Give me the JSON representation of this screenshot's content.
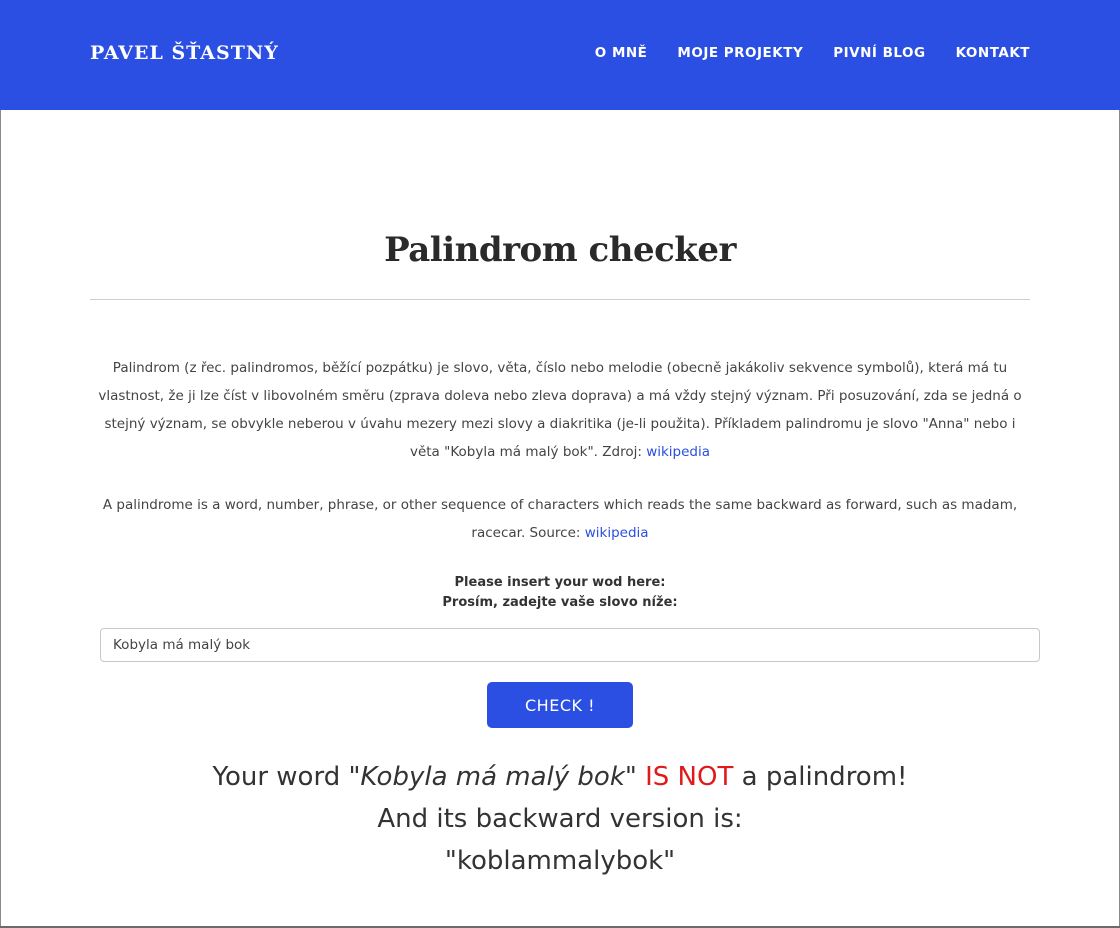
{
  "header": {
    "brand": "PAVEL ŠŤASTNÝ",
    "nav": [
      "O MNĚ",
      "MOJE PROJEKTY",
      "PIVNÍ BLOG",
      "KONTAKT"
    ]
  },
  "main": {
    "title": "Palindrom checker",
    "description_cz": {
      "text": "Palindrom (z řec. palindromos, běžící pozpátku) je slovo, věta, číslo nebo melodie (obecně jakákoliv sekvence symbolů), která má tu vlastnost, že ji lze číst v libovolném směru (zprava doleva nebo zleva doprava) a má vždy stejný význam. Při posuzování, zda se jedná o stejný význam, se obvykle neberou v úvahu mezery mezi slovy a diakritika (je-li použita). Příkladem palindromu je slovo \"Anna\" nebo i věta \"Kobyla má malý bok\". Zdroj:",
      "link": "wikipedia"
    },
    "description_en": {
      "text": "A palindrome is a word, number, phrase, or other sequence of characters which reads the same backward as forward, such as madam, racecar. Source:",
      "link": "wikipedia"
    },
    "prompt_en": "Please insert your wod here:",
    "prompt_cz": "Prosím, zadejte vaše slovo níže:",
    "input_value": "Kobyla má malý bok",
    "check_label": "CHECK !",
    "result": {
      "prefix": "Your word",
      "word": "\"Kobyla má malý bok\"",
      "verdict": "IS NOT",
      "suffix": "a palindrom!",
      "line2": "And its backward version is:",
      "backward": "\"koblammalybok\""
    }
  },
  "colors": {
    "header_bg": "#2a4fe2",
    "accent": "#2a4fe2",
    "verdict": "#e01919"
  }
}
